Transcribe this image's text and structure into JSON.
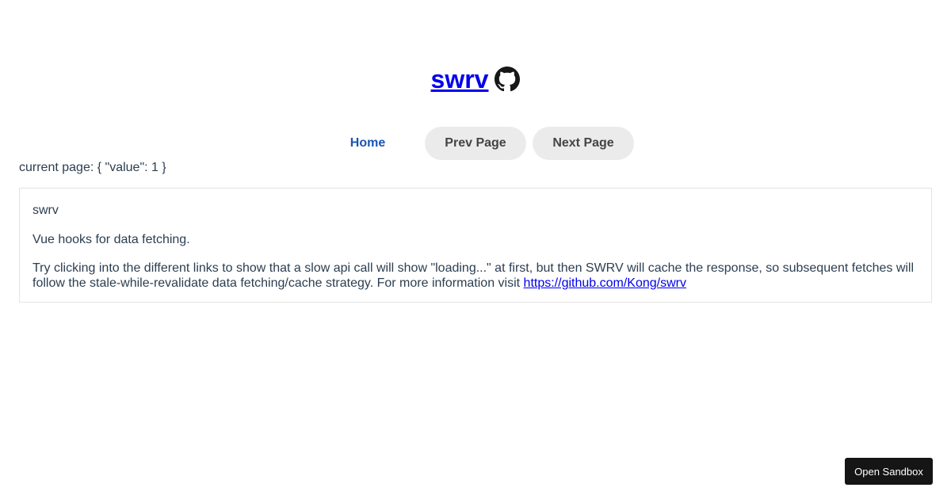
{
  "header": {
    "title": "swrv",
    "icon": "github-icon"
  },
  "nav": {
    "home_label": "Home",
    "prev_label": "Prev Page",
    "next_label": "Next Page"
  },
  "status": {
    "current_page_text": "current page: { \"value\": 1 }"
  },
  "card": {
    "title": "swrv",
    "description": "Vue hooks for data fetching.",
    "body_text": "Try clicking into the different links to show that a slow api call will show \"loading...\" at first, but then SWRV will cache the response, so subsequent fetches will follow the stale-while-revalidate data fetching/cache strategy. For more information visit ",
    "link_text": "https://github.com/Kong/swrv"
  },
  "sandbox": {
    "button_label": "Open Sandbox"
  },
  "colors": {
    "link": "#0000ee",
    "home_accent": "#1a56b4",
    "pill_bg": "#ebebeb",
    "text": "#2c3e50",
    "sandbox_bg": "#151515"
  }
}
